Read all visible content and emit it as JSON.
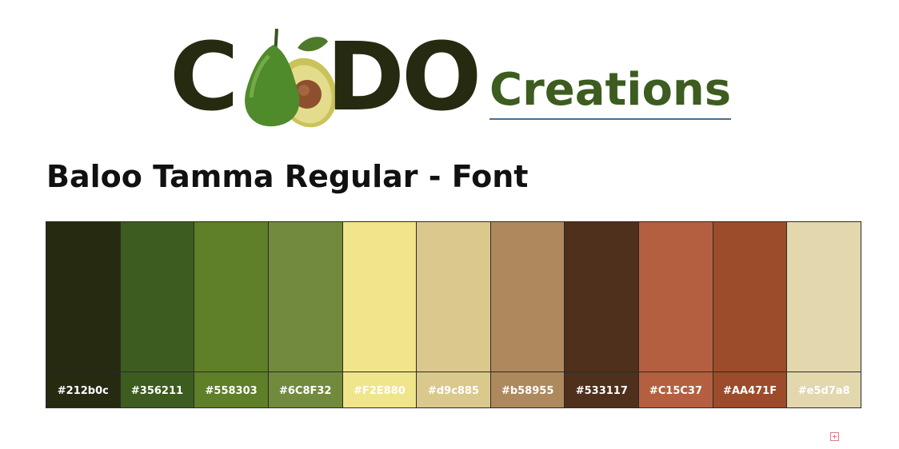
{
  "logo": {
    "letter_c": "C",
    "letters_do": "DO",
    "word": "Creations",
    "avocado_icon": "avocado-icon",
    "colors": {
      "dark": "#262a11",
      "green": "#3d5c20"
    }
  },
  "title": "Baloo Tamma Regular - Font",
  "palette": {
    "swatches": [
      {
        "label": "#212b0c",
        "color": "#262a11"
      },
      {
        "label": "#356211",
        "color": "#3d5c20"
      },
      {
        "label": "#558303",
        "color": "#5f7f28"
      },
      {
        "label": "#6C8F32",
        "color": "#728a3e"
      },
      {
        "label": "#F2E880",
        "color": "#f0e58a"
      },
      {
        "label": "#d9c885",
        "color": "#dac88d"
      },
      {
        "label": "#b58955",
        "color": "#ae895e"
      },
      {
        "label": "#533117",
        "color": "#4e301d"
      },
      {
        "label": "#C15C37",
        "color": "#b35f40"
      },
      {
        "label": "#AA471F",
        "color": "#9c4c2b"
      },
      {
        "label": "#e5d7a8",
        "color": "#e2d7ad"
      }
    ]
  },
  "corner_icon": "add-icon"
}
